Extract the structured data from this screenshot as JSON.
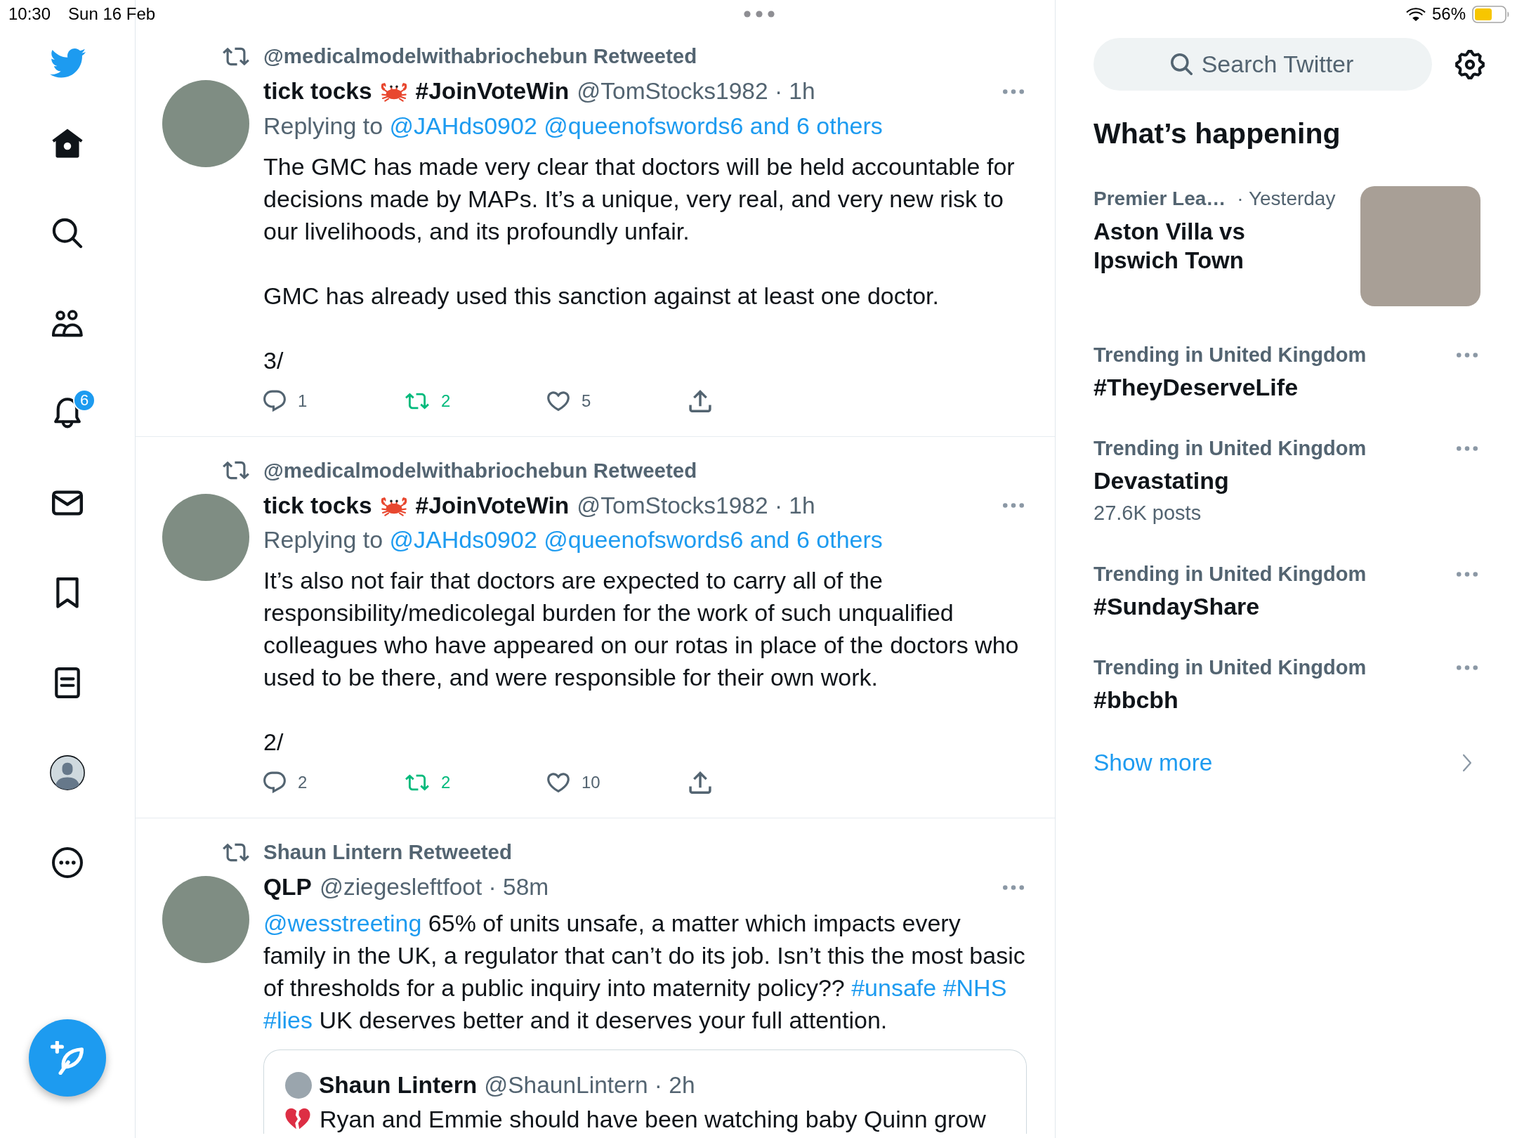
{
  "status_bar": {
    "time": "10:30",
    "date": "Sun 16 Feb",
    "battery": "56%"
  },
  "sidebar": {
    "items": [
      {
        "kind": "home",
        "selected": true
      },
      {
        "kind": "explore",
        "selected": false
      },
      {
        "kind": "communities",
        "selected": false
      },
      {
        "kind": "notifications",
        "selected": false,
        "badge": "6"
      },
      {
        "kind": "messages",
        "selected": false
      },
      {
        "kind": "bookmarks",
        "selected": false
      },
      {
        "kind": "lists",
        "selected": false
      },
      {
        "kind": "profile",
        "selected": false
      },
      {
        "kind": "more",
        "selected": false
      }
    ]
  },
  "timeline": [
    {
      "retweeted_by": "@medicalmodelwithabriochebun Retweeted",
      "author": {
        "name": "tick tocks",
        "name_tag": "#JoinVoteWin",
        "meta": "@TomStocks1982 · 1h"
      },
      "replying": [
        {
          "kind": "text",
          "text": "Replying to "
        },
        {
          "kind": "mention",
          "text": "@JAHds0902 @queenofswords6 and 6 others"
        }
      ],
      "paragraphs": [
        [
          {
            "kind": "text",
            "text": "The GMC has made very clear that doctors will be held accountable for decisions made by MAPs. It’s a unique, very real, and very new risk to our livelihoods, and its profoundly unfair."
          }
        ],
        [
          {
            "kind": "text",
            "text": "GMC has already used this sanction against at least one doctor."
          }
        ],
        [
          {
            "kind": "text",
            "text": "3/"
          }
        ]
      ],
      "actions": {
        "replies": "1",
        "retweets": "2",
        "retweeted": true,
        "likes": "5",
        "liked": false
      }
    },
    {
      "retweeted_by": "@medicalmodelwithabriochebun Retweeted",
      "author": {
        "name": "tick tocks",
        "name_tag": "#JoinVoteWin",
        "meta": "@TomStocks1982 · 1h"
      },
      "replying": [
        {
          "kind": "text",
          "text": "Replying to "
        },
        {
          "kind": "mention",
          "text": "@JAHds0902 @queenofswords6 and 6 others"
        }
      ],
      "paragraphs": [
        [
          {
            "kind": "text",
            "text": "It’s also not fair that doctors are expected to carry all of the responsibility/medicolegal burden for the work of such unqualified colleagues who have appeared on our rotas in place of the doctors who used to be there, and were responsible for their own work."
          }
        ],
        [
          {
            "kind": "text",
            "text": "2/"
          }
        ]
      ],
      "actions": {
        "replies": "2",
        "retweets": "2",
        "retweeted": true,
        "likes": "10",
        "liked": false
      }
    },
    {
      "retweeted_by": "Shaun Lintern Retweeted",
      "author": {
        "name": "QLP",
        "meta": "@ziegesleftfoot · 58m"
      },
      "paragraphs": [
        [
          {
            "kind": "mention",
            "text": "@wesstreeting"
          },
          {
            "kind": "text",
            "text": " 65% of units unsafe, a matter which impacts every family in the UK, a regulator that can’t do its job. Isn’t this the most basic of thresholds for a public inquiry into maternity policy?? "
          },
          {
            "kind": "hashtag",
            "text": "#unsafe"
          },
          {
            "kind": "hashtag",
            "text": "#NHS"
          },
          {
            "kind": "hashtag",
            "text": "#lies"
          },
          {
            "kind": "text",
            "text": " UK deserves better and it deserves your full attention."
          }
        ]
      ],
      "quote": {
        "name": "Shaun Lintern",
        "meta": "@ShaunLintern · 2h",
        "text": "Ryan and Emmie should have been watching baby Quinn grow"
      }
    }
  ],
  "explore": {
    "search": {
      "placeholder": "Search Twitter"
    },
    "title": "What’s happening",
    "event": {
      "category": "Premier Lea…",
      "time": "· Yesterday",
      "title": "Aston Villa vs Ipswich Town"
    },
    "trends": [
      {
        "context": "Trending in United Kingdom",
        "title": "#TheyDeserveLife"
      },
      {
        "context": "Trending in United Kingdom",
        "title": "Devastating",
        "posts": "27.6K posts"
      },
      {
        "context": "Trending in United Kingdom",
        "title": "#SundayShare"
      },
      {
        "context": "Trending in United Kingdom",
        "title": "#bbcbh"
      }
    ],
    "show_more": "Show more"
  }
}
